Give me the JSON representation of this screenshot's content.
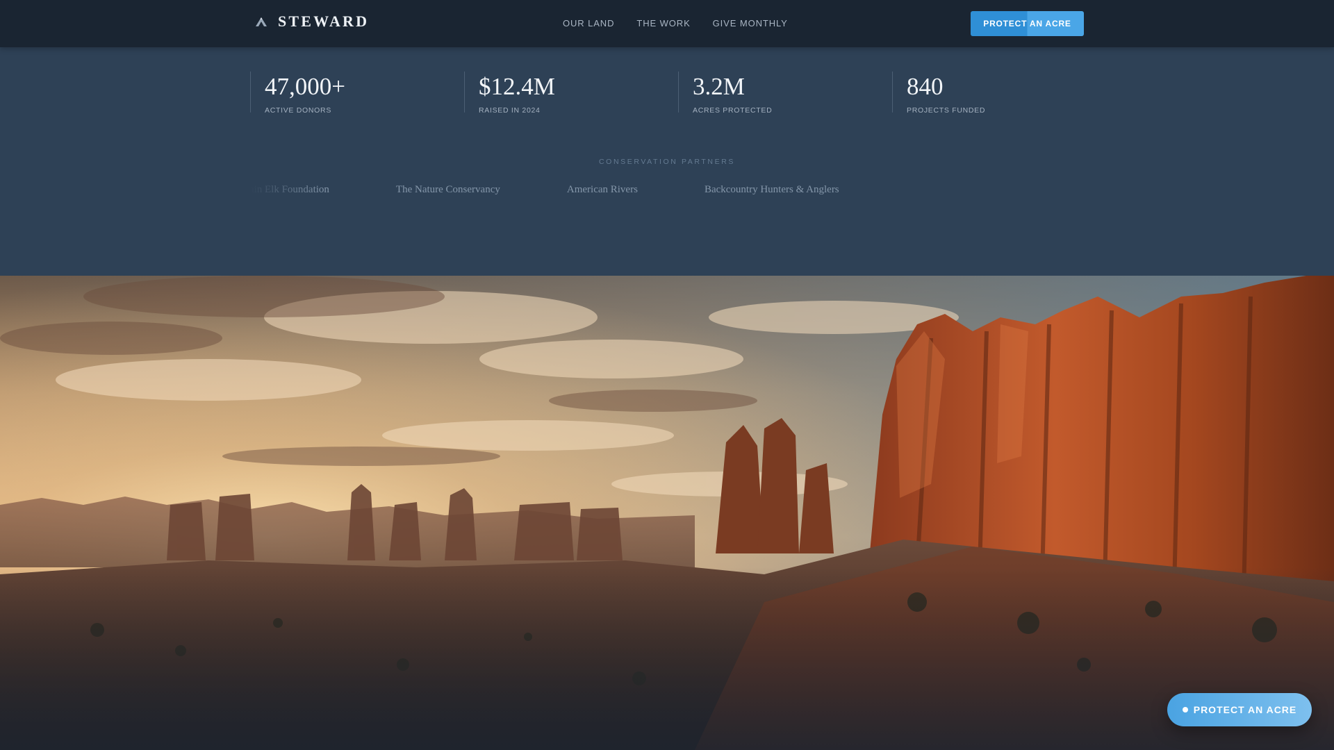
{
  "nav": {
    "brand": "STEWARD",
    "brand_icon": "mountain-icon",
    "links": [
      "OUR LAND",
      "THE WORK",
      "GIVE MONTHLY"
    ],
    "cta_label": "PROTECT AN ACRE"
  },
  "stats": [
    {
      "value": "47,000+",
      "label": "ACTIVE DONORS"
    },
    {
      "value": "$12.4M",
      "label": "RAISED IN 2024"
    },
    {
      "value": "3.2M",
      "label": "ACRES PROTECTED"
    },
    {
      "value": "840",
      "label": "PROJECTS FUNDED"
    }
  ],
  "partners": {
    "heading": "CONSERVATION PARTNERS",
    "items": [
      "Rocky Mountain Elk Foundation",
      "The Nature Conservancy",
      "American Rivers",
      "Backcountry Hunters & Anglers"
    ]
  },
  "floating_cta": {
    "label": "PROTECT AN ACRE"
  },
  "colors": {
    "nav_bg": "#1a2532",
    "page_bg": "#2e4156",
    "accent": "#2f8fd6",
    "accent_light": "#7ec0ee",
    "rock": "#b4502a"
  }
}
